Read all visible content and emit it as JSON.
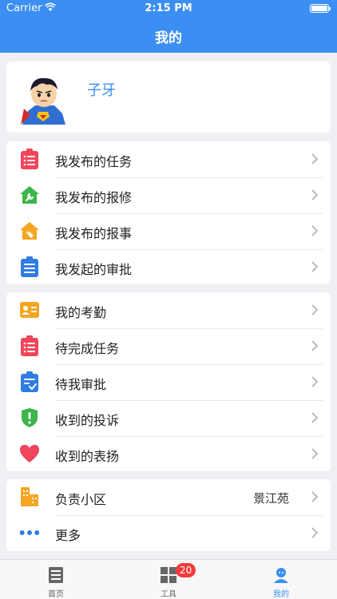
{
  "status_bar": {
    "carrier": "Carrier",
    "time": "2:15 PM"
  },
  "nav": {
    "title": "我的"
  },
  "profile": {
    "name": "子牙"
  },
  "group1": [
    {
      "label": "我发布的任务",
      "icon": "task-list-icon",
      "color": "#f0455a"
    },
    {
      "label": "我发布的报修",
      "icon": "home-wrench-icon",
      "color": "#3cb54a"
    },
    {
      "label": "我发布的报事",
      "icon": "home-tag-icon",
      "color": "#f5a623"
    },
    {
      "label": "我发起的审批",
      "icon": "clipboard-icon",
      "color": "#2f7de1"
    }
  ],
  "group2": [
    {
      "label": "我的考勤",
      "icon": "id-card-icon",
      "color": "#f5a623"
    },
    {
      "label": "待完成任务",
      "icon": "task-list-icon",
      "color": "#f0455a"
    },
    {
      "label": "待我审批",
      "icon": "clipboard-check-icon",
      "color": "#2f7de1"
    },
    {
      "label": "收到的投诉",
      "icon": "shield-alert-icon",
      "color": "#3cb54a"
    },
    {
      "label": "收到的表扬",
      "icon": "heart-icon",
      "color": "#f0455a"
    }
  ],
  "group3": [
    {
      "label": "负责小区",
      "value": "景江苑",
      "icon": "building-icon",
      "color": "#f5a623"
    },
    {
      "label": "更多",
      "icon": "more-dots-icon",
      "color": "#2f7de1"
    }
  ],
  "tabbar": {
    "tabs": [
      {
        "label": "首页",
        "icon": "document-icon"
      },
      {
        "label": "工具",
        "icon": "grid-icon",
        "badge": "20"
      },
      {
        "label": "我的",
        "icon": "user-icon"
      }
    ],
    "active_color": "#3b8ff2"
  },
  "colors": {
    "nav_bar": "#3b8ff2",
    "background": "#efeff4",
    "badge": "#f23b3b"
  }
}
